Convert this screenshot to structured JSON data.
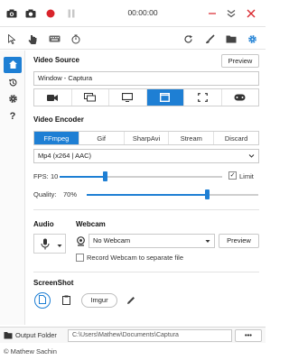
{
  "app": {
    "timer": "00:00:00",
    "copyright": "© Mathew Sachin"
  },
  "icons": {
    "top": [
      "camera-icon",
      "screenshot-icon",
      "record-icon",
      "pause-icon"
    ],
    "window": [
      "minimize-icon",
      "collapse-icon",
      "close-icon"
    ],
    "toolbar": [
      "cursor-icon",
      "click-icon",
      "keyboard-icon",
      "timer-icon",
      "refresh-icon",
      "brush-icon",
      "folder-icon",
      "settings-icon"
    ],
    "sidebar": [
      "home-icon",
      "history-icon",
      "settings-icon",
      "help-icon"
    ]
  },
  "colors": {
    "accent": "#1e7fd4",
    "record_red": "#d9242b"
  },
  "video_source": {
    "title": "Video Source",
    "preview_label": "Preview",
    "current": "Window - Captura",
    "modes": [
      "camera-mode-icon",
      "screen-mode-icon",
      "monitor-mode-icon",
      "window-mode-icon",
      "region-mode-icon",
      "gamepad-mode-icon"
    ],
    "active_mode_index": 3
  },
  "video_encoder": {
    "title": "Video Encoder",
    "tabs": [
      "FFmpeg",
      "Gif",
      "SharpAvi",
      "Stream",
      "Discard"
    ],
    "active_tab": 0,
    "codec": "Mp4 (x264 | AAC)",
    "fps_label": "FPS:",
    "fps_value": "10",
    "fps_level": 0.28,
    "limit_label": "Limit",
    "limit_checked": true,
    "check_mark": "✓",
    "quality_label": "Quality:",
    "quality_value": "70%",
    "quality_level": 0.7
  },
  "audio": {
    "title": "Audio"
  },
  "webcam": {
    "title": "Webcam",
    "selected": "No Webcam",
    "preview_label": "Preview",
    "separate_file_label": "Record Webcam to separate file",
    "separate_file_checked": false
  },
  "screenshot": {
    "title": "ScreenShot",
    "imgur_label": "Imgur"
  },
  "footer": {
    "output_label": "Output Folder",
    "output_path": "C:\\Users\\Mathew\\Documents\\Captura",
    "more_label": "•••"
  }
}
